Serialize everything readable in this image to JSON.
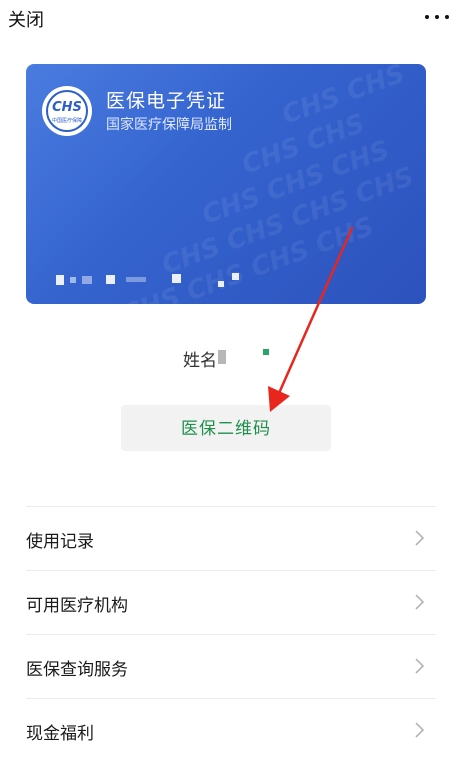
{
  "header": {
    "close_label": "关闭",
    "more_icon": "more-dots-icon"
  },
  "card": {
    "title": "医保电子凭证",
    "subtitle": "国家医疗保障局监制",
    "logo_text": "CHS",
    "logo_sub": "中国医疗保障",
    "logo_icon": "chs-logo-icon",
    "gradient": [
      "#4a7ce0",
      "#2c52bd"
    ]
  },
  "name_label": "姓名",
  "qr_button_label": "医保二维码",
  "menu": [
    {
      "label": "使用记录"
    },
    {
      "label": "可用医疗机构"
    },
    {
      "label": "医保查询服务"
    },
    {
      "label": "现金福利"
    }
  ],
  "colors": {
    "accent_green": "#1f8f4e",
    "arrow_red": "#e8261d"
  }
}
